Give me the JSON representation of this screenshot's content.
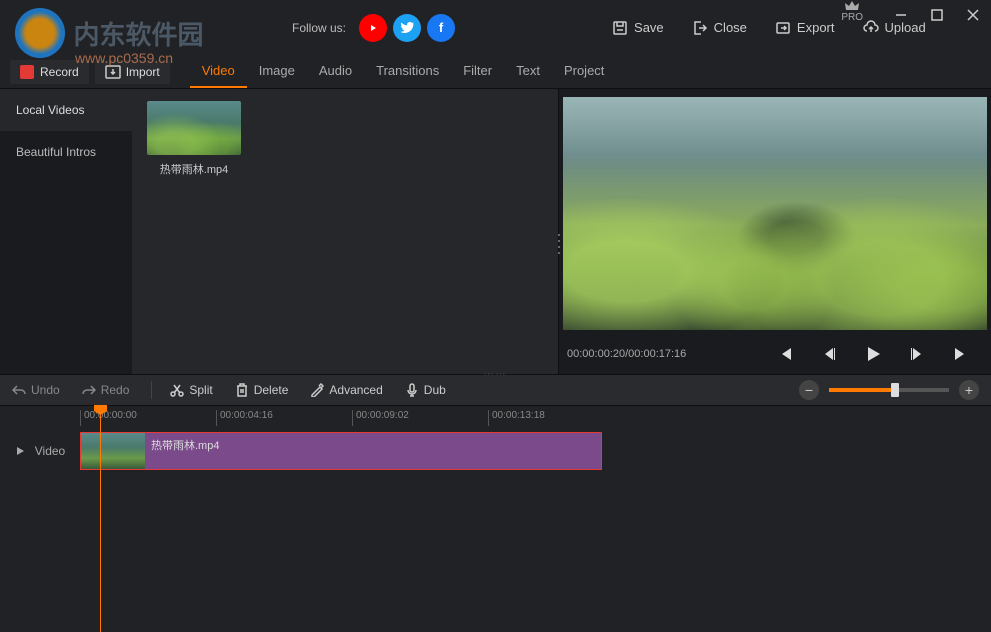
{
  "watermark": {
    "text": "内东软件园",
    "url": "www.pc0359.cn"
  },
  "topbar": {
    "follow_label": "Follow us:",
    "pro_label": "PRO",
    "actions": {
      "save": "Save",
      "close": "Close",
      "export": "Export",
      "upload": "Upload"
    }
  },
  "actionbar": {
    "record": "Record",
    "import": "Import"
  },
  "tabs": [
    "Video",
    "Image",
    "Audio",
    "Transitions",
    "Filter",
    "Text",
    "Project"
  ],
  "active_tab": 0,
  "sidebar": {
    "items": [
      "Local Videos",
      "Beautiful Intros"
    ],
    "active": 0
  },
  "media": {
    "items": [
      {
        "label": "热带雨林.mp4"
      }
    ]
  },
  "preview": {
    "time": "00:00:00:20/00:00:17:16"
  },
  "edit_toolbar": {
    "undo": "Undo",
    "redo": "Redo",
    "split": "Split",
    "delete": "Delete",
    "advanced": "Advanced",
    "dub": "Dub"
  },
  "timeline": {
    "ruler": [
      "00:00:00:00",
      "00:00:04:16",
      "00:00:09:02",
      "00:00:13:18"
    ],
    "track_label": "Video",
    "clip_label": "热带雨林.mp4"
  }
}
